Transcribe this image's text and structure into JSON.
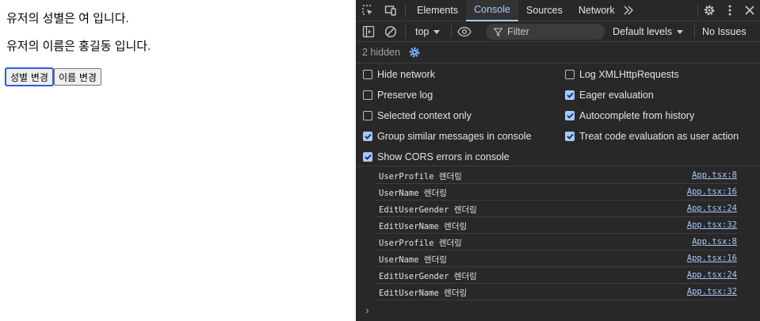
{
  "page": {
    "gender_line": "유저의 성별은 여 입니다.",
    "name_line": "유저의 이름은 홍길동 입니다.",
    "btn_gender": "성별 변경",
    "btn_name": "이름 변경"
  },
  "devtools": {
    "tabs": [
      "Elements",
      "Console",
      "Sources",
      "Network"
    ],
    "active_tab": "Console",
    "toolbar": {
      "context": "top",
      "filter_placeholder": "Filter",
      "levels": "Default levels",
      "issues": "No Issues"
    },
    "hidden_count": "2 hidden",
    "settings": {
      "left": [
        {
          "label": "Hide network",
          "checked": false
        },
        {
          "label": "Preserve log",
          "checked": false
        },
        {
          "label": "Selected context only",
          "checked": false
        },
        {
          "label": "Group similar messages in console",
          "checked": true
        },
        {
          "label": "Show CORS errors in console",
          "checked": true
        }
      ],
      "right": [
        {
          "label": "Log XMLHttpRequests",
          "checked": false
        },
        {
          "label": "Eager evaluation",
          "checked": true
        },
        {
          "label": "Autocomplete from history",
          "checked": true
        },
        {
          "label": "Treat code evaluation as user action",
          "checked": true
        }
      ]
    },
    "messages": [
      {
        "text": "UserProfile 렌더링",
        "source": "App.tsx:8"
      },
      {
        "text": "UserName 렌더링",
        "source": "App.tsx:16"
      },
      {
        "text": "EditUserGender 렌더링",
        "source": "App.tsx:24"
      },
      {
        "text": "EditUserName 렌더링",
        "source": "App.tsx:32"
      },
      {
        "text": "UserProfile 렌더링",
        "source": "App.tsx:8"
      },
      {
        "text": "UserName 렌더링",
        "source": "App.tsx:16"
      },
      {
        "text": "EditUserGender 렌더링",
        "source": "App.tsx:24"
      },
      {
        "text": "EditUserName 렌더링",
        "source": "App.tsx:32"
      }
    ],
    "prompt_glyph": "›",
    "colors": {
      "accent": "#a8c7fa",
      "panel": "#282828",
      "divider": "#3d3d3d"
    }
  }
}
